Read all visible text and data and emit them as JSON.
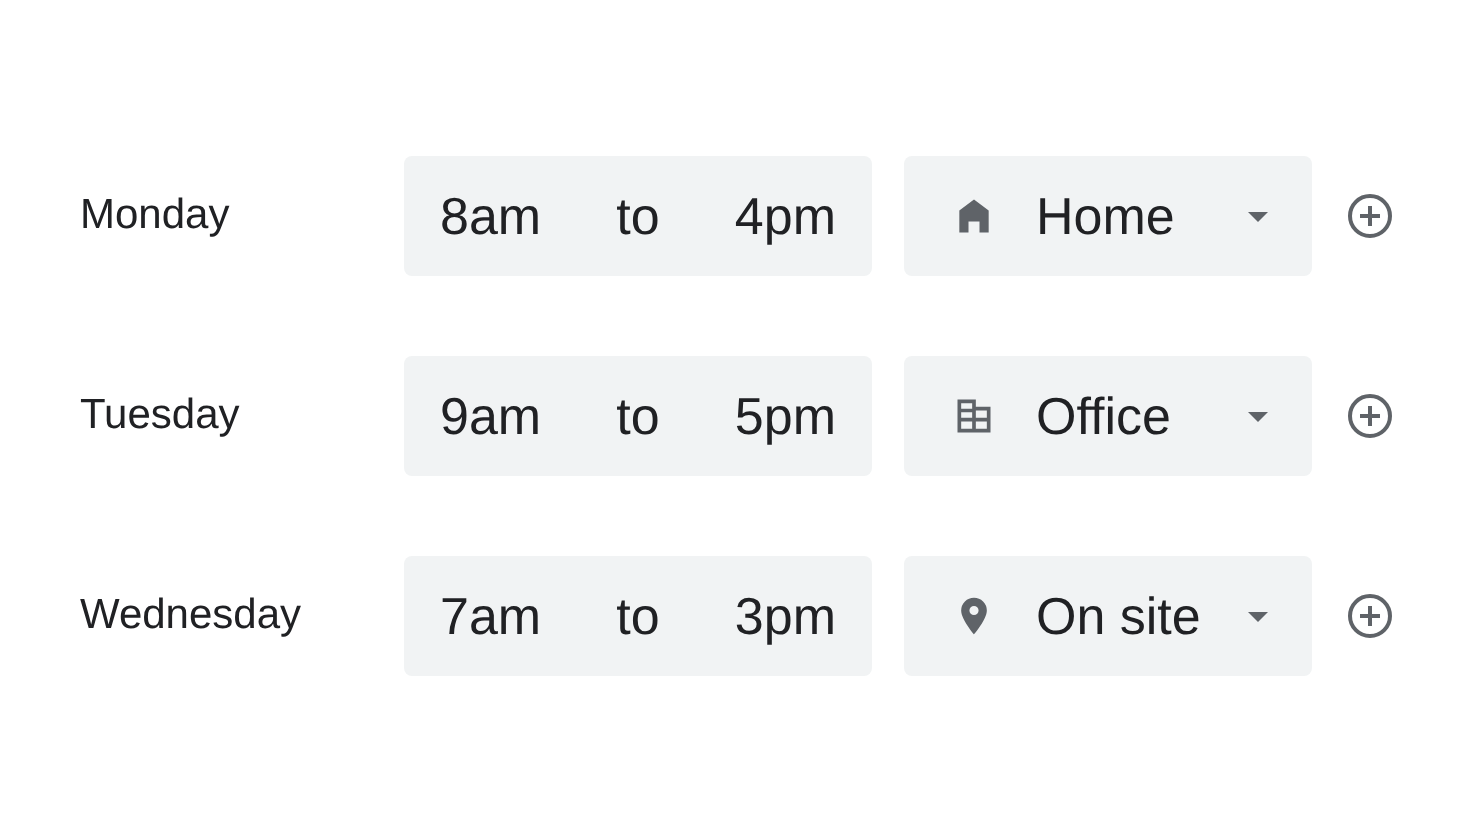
{
  "schedule": [
    {
      "day": "Monday",
      "start": "8am",
      "separator": "to",
      "end": "4pm",
      "location": {
        "kind": "home",
        "label": "Home"
      }
    },
    {
      "day": "Tuesday",
      "start": "9am",
      "separator": "to",
      "end": "5pm",
      "location": {
        "kind": "office",
        "label": "Office"
      }
    },
    {
      "day": "Wednesday",
      "start": "7am",
      "separator": "to",
      "end": "3pm",
      "location": {
        "kind": "site",
        "label": "On site"
      }
    }
  ]
}
